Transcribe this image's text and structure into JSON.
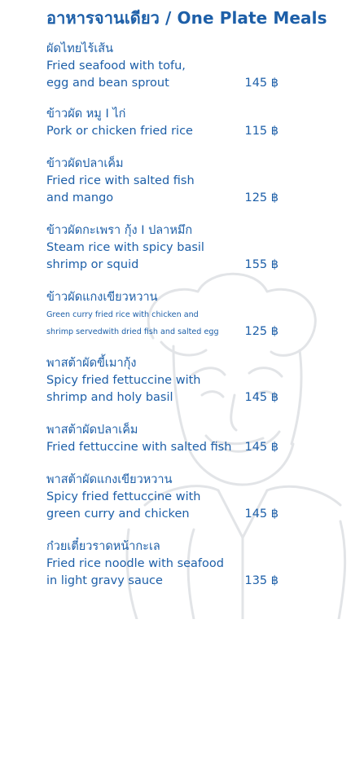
{
  "title": "อาหารจานเดียว / One Plate Meals",
  "colors": {
    "ink": "#1d5fa8"
  },
  "items": [
    {
      "thai": "ผัดไทยไร้เส้น",
      "english": [
        "Fried seafood with tofu,",
        "egg and bean sprout"
      ],
      "price": "145 ฿"
    },
    {
      "thai": "ข้าวผัด หมู I ไก่",
      "english": [
        "Pork or chicken fried rice"
      ],
      "price": "115 ฿"
    },
    {
      "thai": "ข้าวผัดปลาเค็ม",
      "english": [
        "Fried rice with salted fish",
        "and mango"
      ],
      "price": "125 ฿"
    },
    {
      "thai": "ข้าวผัดกะเพรา กุ้ง I ปลาหมึก",
      "english": [
        "Steam rice with spicy basil",
        "shrimp or squid"
      ],
      "price": "155 ฿"
    },
    {
      "thai": "ข้าวผัดแกงเขียวหวาน",
      "english": [
        "Green curry fried rice with chicken and",
        "shrimp servedwith dried fish and salted egg"
      ],
      "price": "125 ฿"
    },
    {
      "thai": "พาสต้าผัดขี้เมากุ้ง",
      "english": [
        "Spicy fried fettuccine with",
        "shrimp and holy basil"
      ],
      "price": "145 ฿"
    },
    {
      "thai": "พาสต้าผัดปลาเค็ม",
      "english": [
        "Fried fettuccine with salted fish"
      ],
      "price": "145 ฿"
    },
    {
      "thai": "พาสต้าผัดแกงเขียวหวาน",
      "english": [
        "Spicy fried fettuccine with",
        "green curry and chicken"
      ],
      "price": "145 ฿"
    },
    {
      "thai": "ก๋วยเตี๋ยวราดหน้ากะเล",
      "english": [
        "Fried rice noodle with seafood",
        "in light gravy sauce"
      ],
      "price": "135 ฿"
    }
  ]
}
